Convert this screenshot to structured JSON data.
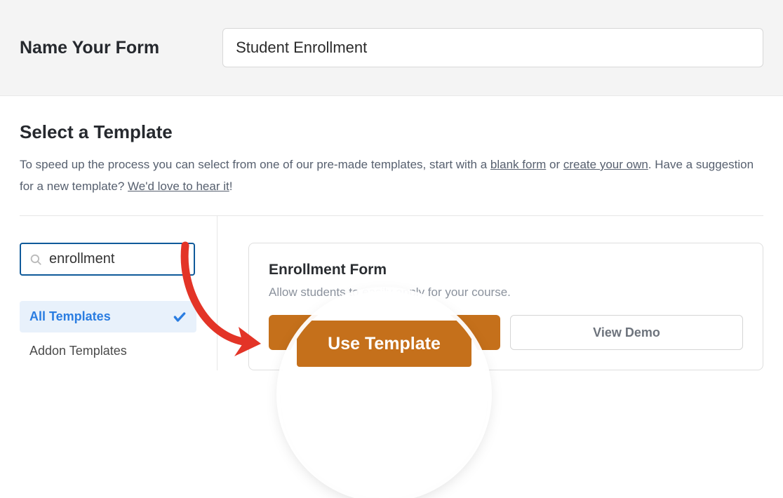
{
  "header": {
    "name_label": "Name Your Form",
    "name_value": "Student Enrollment"
  },
  "section": {
    "title": "Select a Template",
    "desc_prefix": "To speed up the process you can select from one of our pre-made templates, start with a ",
    "link_blank": "blank form",
    "desc_mid": " or ",
    "link_create": "create your own",
    "desc_suffix": ". Have a suggestion for a new template? ",
    "link_hear": "We'd love to hear it",
    "desc_end": "!"
  },
  "sidebar": {
    "search_value": "enrollment",
    "categories": {
      "all_label": "All Templates",
      "addon_label": "Addon Templates"
    }
  },
  "card": {
    "title": "Enrollment Form",
    "desc": "Allow students to easily apply for your course.",
    "use_label": "Use Template",
    "demo_label": "View Demo"
  },
  "magnifier": {
    "label": "Use Template"
  }
}
